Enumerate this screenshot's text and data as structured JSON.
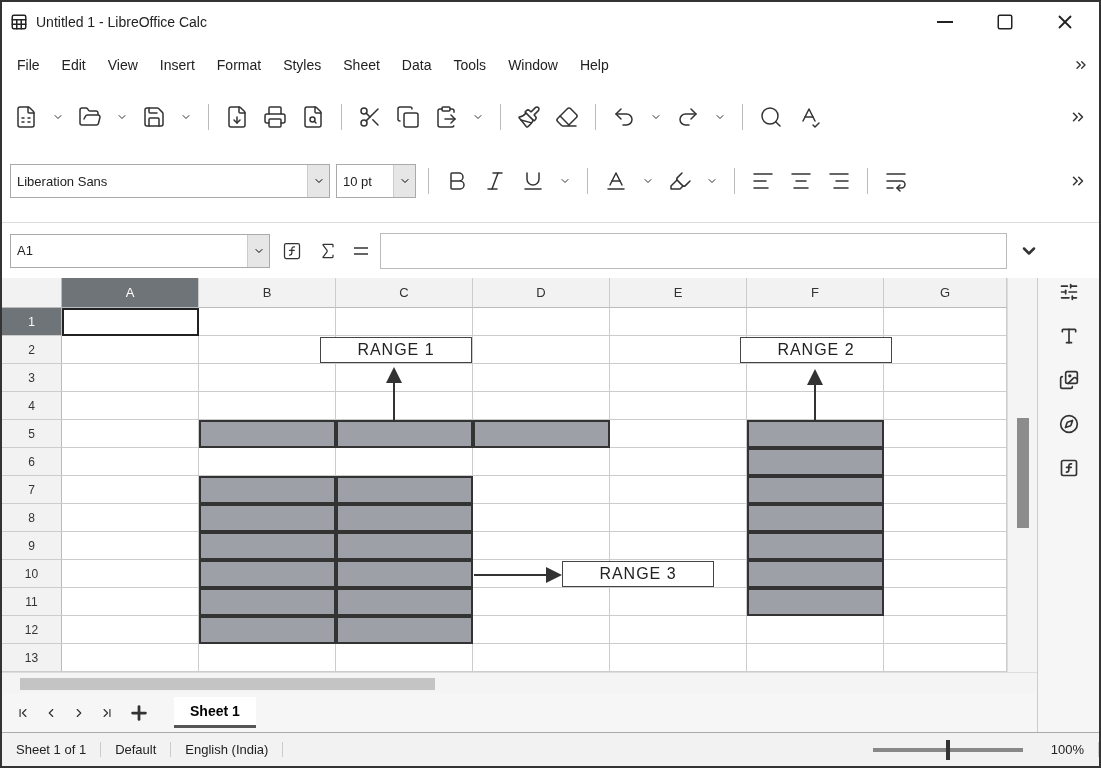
{
  "window": {
    "title": "Untitled 1 - LibreOffice Calc"
  },
  "menu": [
    "File",
    "Edit",
    "View",
    "Insert",
    "Format",
    "Styles",
    "Sheet",
    "Data",
    "Tools",
    "Window",
    "Help"
  ],
  "format_bar": {
    "font_name": "Liberation Sans",
    "font_size": "10 pt"
  },
  "formula_bar": {
    "name_box": "A1"
  },
  "sheet": {
    "columns": [
      {
        "label": "A",
        "selected": true
      },
      {
        "label": "B",
        "selected": false
      },
      {
        "label": "C",
        "selected": false
      },
      {
        "label": "D",
        "selected": false
      },
      {
        "label": "E",
        "selected": false
      },
      {
        "label": "F",
        "selected": false
      },
      {
        "label": "G",
        "selected": false
      }
    ],
    "rows": [
      {
        "label": "1",
        "selected": true,
        "cells": [
          {
            "kind": "blank"
          },
          {
            "kind": "blank"
          },
          {
            "kind": "blank"
          },
          {
            "kind": "blank"
          },
          {
            "kind": "blank"
          },
          {
            "kind": "blank"
          },
          {
            "kind": "blank"
          }
        ]
      },
      {
        "label": "2",
        "selected": false,
        "cells": [
          {
            "kind": "blank"
          },
          {
            "kind": "blank"
          },
          {
            "kind": "blank"
          },
          {
            "kind": "blank"
          },
          {
            "kind": "blank"
          },
          {
            "kind": "blank"
          },
          {
            "kind": "blank"
          }
        ]
      },
      {
        "label": "3",
        "selected": false,
        "cells": [
          {
            "kind": "blank"
          },
          {
            "kind": "blank"
          },
          {
            "kind": "blank"
          },
          {
            "kind": "blank"
          },
          {
            "kind": "blank"
          },
          {
            "kind": "blank"
          },
          {
            "kind": "blank"
          }
        ]
      },
      {
        "label": "4",
        "selected": false,
        "cells": [
          {
            "kind": "blank"
          },
          {
            "kind": "blank"
          },
          {
            "kind": "blank"
          },
          {
            "kind": "blank"
          },
          {
            "kind": "blank"
          },
          {
            "kind": "blank"
          },
          {
            "kind": "blank"
          }
        ]
      },
      {
        "label": "5",
        "selected": false,
        "cells": [
          {
            "kind": "blank"
          },
          {
            "kind": "shaded"
          },
          {
            "kind": "shaded"
          },
          {
            "kind": "shaded"
          },
          {
            "kind": "blank"
          },
          {
            "kind": "shaded"
          },
          {
            "kind": "blank"
          }
        ]
      },
      {
        "label": "6",
        "selected": false,
        "cells": [
          {
            "kind": "blank"
          },
          {
            "kind": "blank"
          },
          {
            "kind": "blank"
          },
          {
            "kind": "blank"
          },
          {
            "kind": "blank"
          },
          {
            "kind": "shaded"
          },
          {
            "kind": "blank"
          }
        ]
      },
      {
        "label": "7",
        "selected": false,
        "cells": [
          {
            "kind": "blank"
          },
          {
            "kind": "shaded"
          },
          {
            "kind": "shaded"
          },
          {
            "kind": "blank"
          },
          {
            "kind": "blank"
          },
          {
            "kind": "shaded"
          },
          {
            "kind": "blank"
          }
        ]
      },
      {
        "label": "8",
        "selected": false,
        "cells": [
          {
            "kind": "blank"
          },
          {
            "kind": "shaded"
          },
          {
            "kind": "shaded"
          },
          {
            "kind": "blank"
          },
          {
            "kind": "blank"
          },
          {
            "kind": "shaded"
          },
          {
            "kind": "blank"
          }
        ]
      },
      {
        "label": "9",
        "selected": false,
        "cells": [
          {
            "kind": "blank"
          },
          {
            "kind": "shaded"
          },
          {
            "kind": "shaded"
          },
          {
            "kind": "blank"
          },
          {
            "kind": "blank"
          },
          {
            "kind": "shaded"
          },
          {
            "kind": "blank"
          }
        ]
      },
      {
        "label": "10",
        "selected": false,
        "cells": [
          {
            "kind": "blank"
          },
          {
            "kind": "shaded"
          },
          {
            "kind": "shaded"
          },
          {
            "kind": "blank"
          },
          {
            "kind": "blank"
          },
          {
            "kind": "shaded"
          },
          {
            "kind": "blank"
          }
        ]
      },
      {
        "label": "11",
        "selected": false,
        "cells": [
          {
            "kind": "blank"
          },
          {
            "kind": "shaded"
          },
          {
            "kind": "shaded"
          },
          {
            "kind": "blank"
          },
          {
            "kind": "blank"
          },
          {
            "kind": "shaded"
          },
          {
            "kind": "blank"
          }
        ]
      },
      {
        "label": "12",
        "selected": false,
        "cells": [
          {
            "kind": "blank"
          },
          {
            "kind": "shaded"
          },
          {
            "kind": "shaded"
          },
          {
            "kind": "blank"
          },
          {
            "kind": "blank"
          },
          {
            "kind": "blank"
          },
          {
            "kind": "blank"
          }
        ]
      },
      {
        "label": "13",
        "selected": false,
        "cells": [
          {
            "kind": "blank"
          },
          {
            "kind": "blank"
          },
          {
            "kind": "blank"
          },
          {
            "kind": "blank"
          },
          {
            "kind": "blank"
          },
          {
            "kind": "blank"
          },
          {
            "kind": "blank"
          }
        ]
      }
    ],
    "callouts": [
      "RANGE 1",
      "RANGE 2",
      "RANGE 3"
    ]
  },
  "sheet_tabs": [
    {
      "label": "Sheet 1",
      "selected": true
    }
  ],
  "status_bar": {
    "sheet": "Sheet 1 of 1",
    "page_style": "Default",
    "language": "English (India)",
    "zoom": {
      "level": 0.5,
      "reading": "100%"
    }
  }
}
